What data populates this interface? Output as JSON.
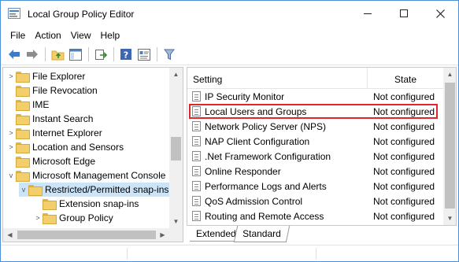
{
  "window": {
    "title": "Local Group Policy Editor",
    "icon": "policy-editor-icon"
  },
  "menu": [
    "File",
    "Action",
    "View",
    "Help"
  ],
  "toolbar": {
    "icons": [
      "back-arrow-icon",
      "forward-arrow-icon",
      "up-folder-icon",
      "show-hide-tree-icon",
      "export-list-icon",
      "help-icon",
      "properties-icon",
      "filter-icon"
    ]
  },
  "tree": {
    "items": [
      {
        "label": "File Explorer",
        "expand": ">"
      },
      {
        "label": "File Revocation",
        "expand": ""
      },
      {
        "label": "IME",
        "expand": ""
      },
      {
        "label": "Instant Search",
        "expand": ""
      },
      {
        "label": "Internet Explorer",
        "expand": ">"
      },
      {
        "label": "Location and Sensors",
        "expand": ">"
      },
      {
        "label": "Microsoft Edge",
        "expand": ""
      },
      {
        "label": "Microsoft Management Console",
        "expand": "v"
      },
      {
        "label": "Restricted/Permitted snap-ins",
        "expand": "v",
        "selected": true
      },
      {
        "label": "Extension snap-ins",
        "expand": ""
      },
      {
        "label": "Group Policy",
        "expand": ">"
      }
    ]
  },
  "list": {
    "header": {
      "setting": "Setting",
      "state": "State"
    },
    "rows": [
      {
        "name": "IP Security Monitor",
        "state": "Not configured"
      },
      {
        "name": "Local Users and Groups",
        "state": "Not configured",
        "highlighted": true
      },
      {
        "name": "Network Policy Server (NPS)",
        "state": "Not configured"
      },
      {
        "name": "NAP Client Configuration",
        "state": "Not configured"
      },
      {
        "name": ".Net Framework Configuration",
        "state": "Not configured"
      },
      {
        "name": "Online Responder",
        "state": "Not configured"
      },
      {
        "name": "Performance Logs and Alerts",
        "state": "Not configured"
      },
      {
        "name": "QoS Admission Control",
        "state": "Not configured"
      },
      {
        "name": "Routing and Remote Access",
        "state": "Not configured"
      }
    ]
  },
  "tabs": {
    "extended": "Extended",
    "standard": "Standard",
    "active": "Standard"
  },
  "colors": {
    "highlight_border": "#e0262c",
    "selection": "#cce4f7",
    "window_border": "#4a90d9"
  }
}
